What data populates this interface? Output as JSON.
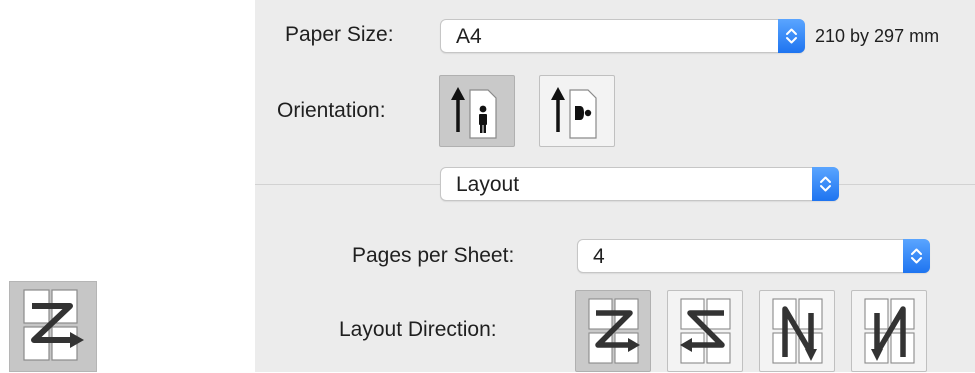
{
  "page_setup": {
    "paper_size_label": "Paper Size:",
    "paper_size_value": "A4",
    "paper_dimensions": "210 by 297 mm",
    "orientation_label": "Orientation:",
    "orientation_options": [
      "portrait",
      "landscape"
    ],
    "orientation_selected": "portrait"
  },
  "section_popup": {
    "value": "Layout"
  },
  "layout": {
    "pages_per_sheet_label": "Pages per Sheet:",
    "pages_per_sheet_value": "4",
    "layout_direction_label": "Layout Direction:",
    "layout_direction_options": [
      "z-order",
      "reverse-z",
      "reverse-n",
      "n-order"
    ],
    "layout_direction_selected": "z-order"
  },
  "colors": {
    "panel_bg": "#ececec",
    "accent_blue": "#1e74f0",
    "selected_tile": "#c9c9c9"
  }
}
